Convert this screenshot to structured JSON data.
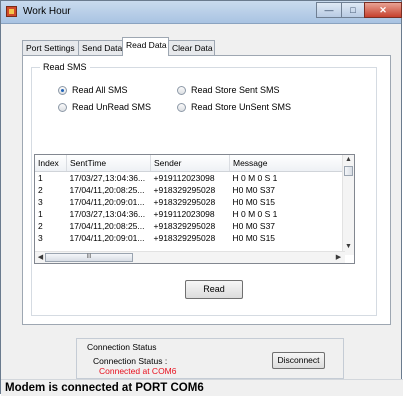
{
  "window": {
    "title": "Work Hour"
  },
  "tabs": [
    {
      "label": "Port Settings"
    },
    {
      "label": "Send Data"
    },
    {
      "label": "Read Data"
    },
    {
      "label": "Clear Data"
    }
  ],
  "read_sms": {
    "group_title": "Read SMS",
    "options": [
      {
        "label": "Read All SMS",
        "checked": true
      },
      {
        "label": "Read Store Sent SMS",
        "checked": false
      },
      {
        "label": "Read UnRead SMS",
        "checked": false
      },
      {
        "label": "Read Store UnSent SMS",
        "checked": false
      }
    ]
  },
  "grid": {
    "columns": [
      "Index",
      "SentTime",
      "Sender",
      "Message"
    ],
    "rows": [
      [
        "1",
        "17/03/27,13:04:36...",
        "+919112023098",
        "H 0 M 0 S 1"
      ],
      [
        "2",
        "17/04/11,20:08:25...",
        "+918329295028",
        "H0 M0 S37"
      ],
      [
        "3",
        "17/04/11,20:09:01...",
        "+918329295028",
        "H0 M0 S15"
      ],
      [
        "1",
        "17/03/27,13:04:36...",
        "+919112023098",
        "H 0 M 0 S 1"
      ],
      [
        "2",
        "17/04/11,20:08:25...",
        "+918329295028",
        "H0 M0 S37"
      ],
      [
        "3",
        "17/04/11,20:09:01...",
        "+918329295028",
        "H0 M0 S15"
      ]
    ],
    "scroll_thumb_glyph": "III"
  },
  "read_button": {
    "label": "Read"
  },
  "connection": {
    "group_title": "Connection Status",
    "status_label": "Connection Status :",
    "status_value": "Connected at COM6",
    "status_color": "#e8101e",
    "disconnect_label": "Disconnect"
  },
  "statusbar": {
    "text": "Modem is connected at PORT COM6"
  }
}
